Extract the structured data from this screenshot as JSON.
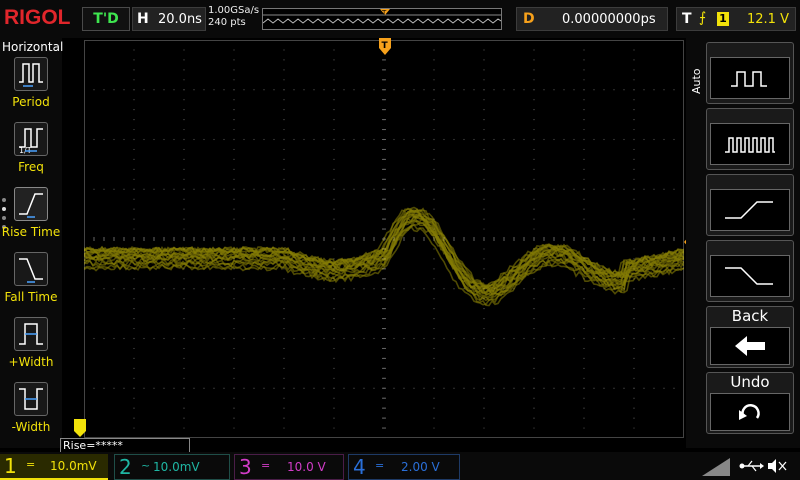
{
  "header": {
    "logo": "RIGOL",
    "status": "T'D",
    "horizontal_label": "H",
    "timebase": "20.0ns",
    "sample_rate": "1.00GSa/s",
    "points": "240 pts",
    "delay_label": "D",
    "delay": "0.00000000ps",
    "trigger_label": "T",
    "trigger_edge": "⨍",
    "trigger_source": "1",
    "trigger_level": "12.1 V"
  },
  "left_menu": {
    "title": "Horizontal",
    "items": [
      {
        "label": "Period"
      },
      {
        "label": "Freq"
      },
      {
        "label": "Rise Time"
      },
      {
        "label": "Fall Time"
      },
      {
        "label": "+Width"
      },
      {
        "label": "-Width"
      }
    ]
  },
  "right_menu": {
    "mode": "Auto",
    "back_label": "Back",
    "undo_label": "Undo"
  },
  "measurement": "Rise=*****",
  "channels": [
    {
      "num": "1",
      "coupling": "=",
      "scale": "10.0mV",
      "color": "#f2e20a"
    },
    {
      "num": "2",
      "coupling": "~",
      "scale": "10.0mV",
      "color": "#1fb6a3"
    },
    {
      "num": "3",
      "coupling": "=",
      "scale": "10.0 V",
      "color": "#d23cc8"
    },
    {
      "num": "4",
      "coupling": "=",
      "scale": "2.00 V",
      "color": "#2a6fd8"
    }
  ],
  "colors": {
    "ch1": "#f2e20a",
    "trigger": "#f7a11b",
    "brand": "#e0262b",
    "run_status": "#3ee64f"
  }
}
